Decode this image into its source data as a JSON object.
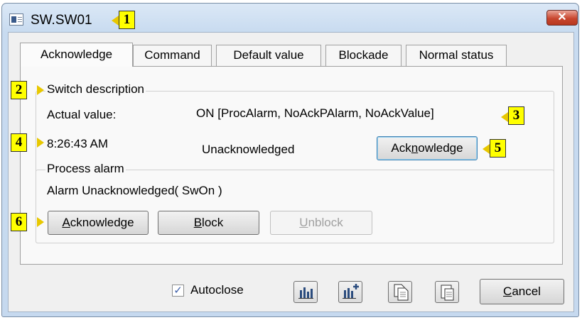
{
  "window": {
    "title": "SW.SW01",
    "close_symbol": "✕"
  },
  "callouts": [
    "1",
    "2",
    "3",
    "4",
    "5",
    "6"
  ],
  "tabs": [
    {
      "label": "Acknowledge",
      "active": true
    },
    {
      "label": "Command",
      "active": false
    },
    {
      "label": "Default value",
      "active": false
    },
    {
      "label": "Blockade",
      "active": false
    },
    {
      "label": "Normal status",
      "active": false
    }
  ],
  "switch_description": {
    "legend": "Switch description",
    "actual_value_label": "Actual value:",
    "actual_value": "ON [ProcAlarm, NoAckPAlarm, NoAckValue]",
    "time": "8:26:43 AM",
    "status": "Unacknowledged",
    "acknowledge_button": {
      "pre": "Ack",
      "accel": "n",
      "post": "owledge"
    }
  },
  "process_alarm": {
    "legend": "Process alarm",
    "text": "Alarm Unacknowledged( SwOn )",
    "acknowledge_button": {
      "pre": "",
      "accel": "A",
      "post": "cknowledge"
    },
    "block_button": {
      "pre": "",
      "accel": "B",
      "post": "lock"
    },
    "unblock_button": {
      "pre": "",
      "accel": "U",
      "post": "nblock",
      "enabled": false
    }
  },
  "footer": {
    "autoclose_label": "Autoclose",
    "autoclose_checked": true,
    "check_mark": "✓",
    "icons": [
      "bar-chart-icon",
      "bar-chart-add-icon",
      "copy-icon",
      "paste-icon"
    ],
    "cancel_button": {
      "pre": "",
      "accel": "C",
      "post": "ancel"
    }
  },
  "colors": {
    "callout_fill": "#ffff00",
    "close_button": "#c8472f",
    "title_bar": "#c8dbf0"
  }
}
